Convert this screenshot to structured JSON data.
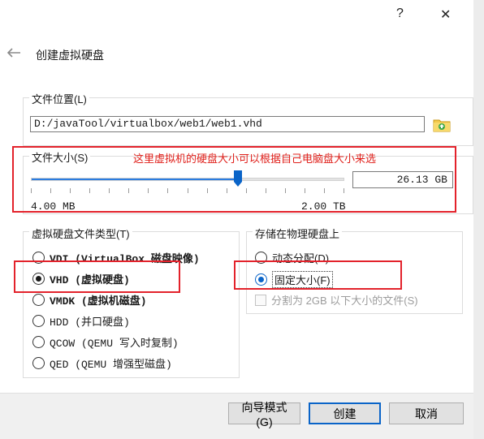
{
  "window": {
    "help_icon": "?",
    "close_icon": "✕"
  },
  "wizard": {
    "title": "创建虚拟硬盘"
  },
  "file_location": {
    "group_label": "文件位置(L)",
    "path": "D:/javaTool/virtualbox/web1/web1.vhd"
  },
  "file_size": {
    "group_label": "文件大小(S)",
    "annotation": "这里虚拟机的硬盘大小可以根据自己电脑盘大小来选",
    "value": "26.13 GB",
    "min_label": "4.00 MB",
    "max_label": "2.00 TB",
    "slider_fraction": 0.66
  },
  "disk_type": {
    "group_label": "虚拟硬盘文件类型(T)",
    "options": [
      {
        "label": "VDI (VirtualBox 磁盘映像)",
        "selected": false
      },
      {
        "label": "VHD (虚拟硬盘)",
        "selected": true
      },
      {
        "label": "VMDK (虚拟机磁盘)",
        "selected": false
      },
      {
        "label": "HDD (并口硬盘)",
        "selected": false
      },
      {
        "label": "QCOW (QEMU 写入时复制)",
        "selected": false
      },
      {
        "label": "QED (QEMU 增强型磁盘)",
        "selected": false
      }
    ]
  },
  "storage": {
    "group_label": "存储在物理硬盘上",
    "dynamic_label": "动态分配(D)",
    "fixed_label": "固定大小(F)",
    "split_label": "分割为 2GB 以下大小的文件(S)",
    "selected": "fixed"
  },
  "buttons": {
    "guided_mode": "向导模式(G)",
    "create": "创建",
    "cancel": "取消"
  },
  "colors": {
    "accent": "#0a64c8",
    "annotation_red": "#e3222b",
    "slider_blue": "#2b7ce0"
  }
}
